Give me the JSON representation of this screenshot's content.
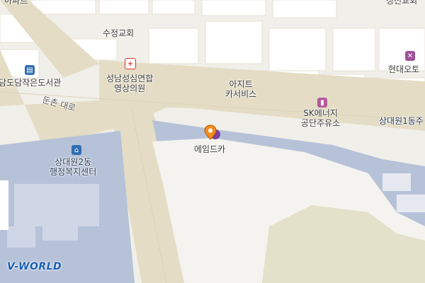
{
  "map": {
    "colors": {
      "background": "#f1efe9",
      "road": "#e4dcc4",
      "water_area": "#b6c2d8",
      "block": "#ffffff",
      "green": "#e3e1c9"
    }
  },
  "labels": {
    "top_left": "아파트",
    "top_right": "성신교회",
    "church": "수정교회",
    "clinic": "성남성심연합\n영상의원",
    "library": "담도담작은도서관",
    "garage": "아지트\n카서비스",
    "gas_station": "SK에너지\n공단주유소",
    "road_name": "둔촌 대로",
    "auto": "현대오토",
    "community_center_right": "상대원1동주",
    "community_center_left": "상대원2동\n행정복지센터",
    "selected_place": "에임드카"
  },
  "icons": {
    "clinic": "hospital-cross-icon",
    "library": "library-icon",
    "gas_station": "gas-station-icon",
    "auto": "wrench-icon",
    "community_center": "home-icon",
    "selected_place": "map-pin-icon"
  },
  "branding": {
    "logo_text": "V-WORLD"
  }
}
